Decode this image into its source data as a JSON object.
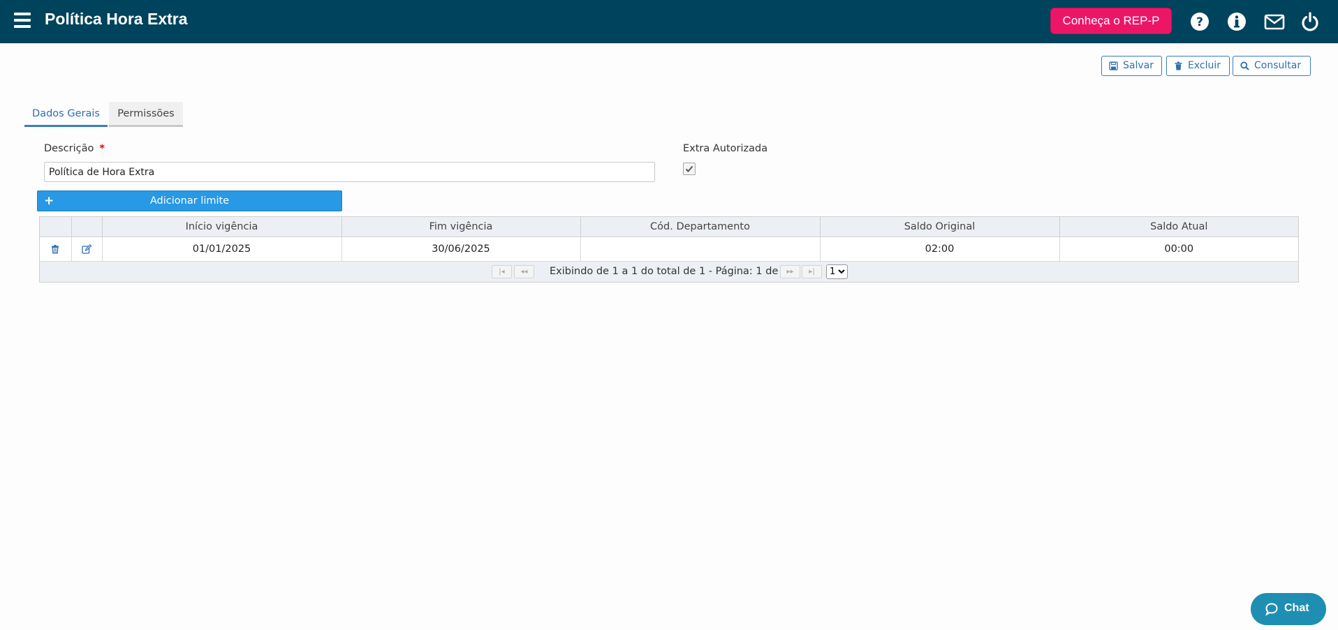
{
  "header": {
    "title": "Política Hora Extra",
    "rep_button": "Conheça o REP-P",
    "icons": [
      "help-icon",
      "info-icon",
      "mail-icon",
      "power-icon"
    ],
    "background": "#00435c",
    "accent": "#ec1667"
  },
  "toolbar": {
    "save_label": "Salvar",
    "delete_label": "Excluir",
    "search_label": "Consultar"
  },
  "tabs": [
    {
      "label": "Dados Gerais",
      "active": true
    },
    {
      "label": "Permissões",
      "active": false
    }
  ],
  "form": {
    "description_label": "Descrição",
    "required_mark": "*",
    "description_value": "Política de Hora Extra",
    "extra_label": "Extra Autorizada",
    "extra_checked": true,
    "add_limit_label": "Adicionar limite"
  },
  "grid": {
    "columns": [
      "Início vigência",
      "Fim vigência",
      "Cód. Departamento",
      "Saldo Original",
      "Saldo Atual"
    ],
    "rows": [
      {
        "inicio": "01/01/2025",
        "fim": "30/06/2025",
        "departamento": "",
        "saldo_original": "02:00",
        "saldo_atual": "00:00"
      }
    ],
    "pager_text": "Exibindo de 1 a 1 do total de 1 - Página: 1 de 1",
    "page_options": [
      "1"
    ],
    "page_selected": "1"
  },
  "chat": {
    "label": "Chat"
  }
}
